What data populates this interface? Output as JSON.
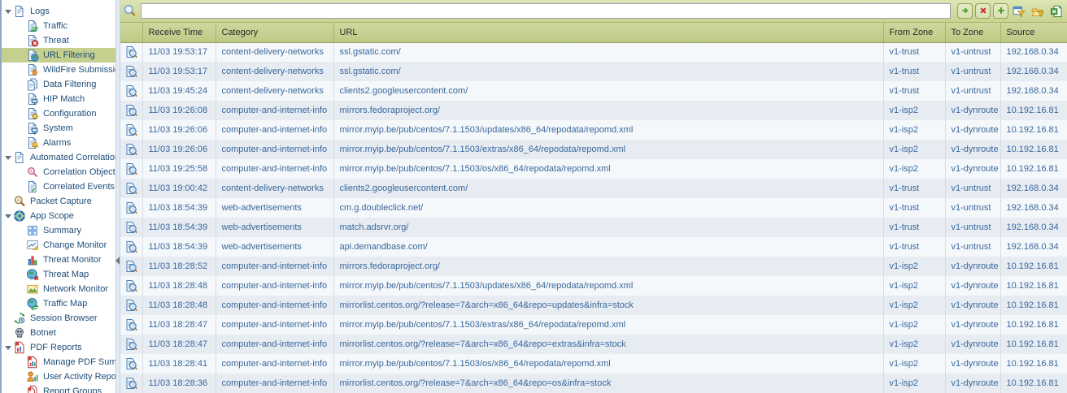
{
  "colors": {
    "accent_olive": "#c5cf8e",
    "header_olive": "#c4ce8c",
    "table_text_blue": "#39679b",
    "alt_row_blue": "#e7ecf3",
    "selected_nav_bg": "#c5cf8e"
  },
  "sidebar": {
    "items": [
      {
        "label": "Logs",
        "level": 0,
        "expandable": true,
        "expanded": true,
        "selected": false,
        "icon": "logs-icon"
      },
      {
        "label": "Traffic",
        "level": 1,
        "selected": false,
        "icon": "traffic-icon"
      },
      {
        "label": "Threat",
        "level": 1,
        "selected": false,
        "icon": "threat-icon"
      },
      {
        "label": "URL Filtering",
        "level": 1,
        "selected": true,
        "icon": "url-filtering-icon"
      },
      {
        "label": "WildFire Submissions",
        "level": 1,
        "selected": false,
        "icon": "wildfire-submissions-icon"
      },
      {
        "label": "Data Filtering",
        "level": 1,
        "selected": false,
        "icon": "data-filtering-icon"
      },
      {
        "label": "HIP Match",
        "level": 1,
        "selected": false,
        "icon": "hip-match-icon"
      },
      {
        "label": "Configuration",
        "level": 1,
        "selected": false,
        "icon": "configuration-icon"
      },
      {
        "label": "System",
        "level": 1,
        "selected": false,
        "icon": "system-icon"
      },
      {
        "label": "Alarms",
        "level": 1,
        "selected": false,
        "icon": "alarms-icon"
      },
      {
        "label": "Automated Correlation",
        "level": 0,
        "expandable": true,
        "expanded": true,
        "selected": false,
        "icon": "automated-correlation-icon"
      },
      {
        "label": "Correlation Objects",
        "level": 1,
        "selected": false,
        "icon": "correlation-objects-icon"
      },
      {
        "label": "Correlated Events",
        "level": 1,
        "selected": false,
        "icon": "correlated-events-icon"
      },
      {
        "label": "Packet Capture",
        "level": 0,
        "expandable": false,
        "selected": false,
        "icon": "packet-capture-icon"
      },
      {
        "label": "App Scope",
        "level": 0,
        "expandable": true,
        "expanded": true,
        "selected": false,
        "icon": "app-scope-icon"
      },
      {
        "label": "Summary",
        "level": 1,
        "selected": false,
        "icon": "summary-icon"
      },
      {
        "label": "Change Monitor",
        "level": 1,
        "selected": false,
        "icon": "change-monitor-icon"
      },
      {
        "label": "Threat Monitor",
        "level": 1,
        "selected": false,
        "icon": "threat-monitor-icon"
      },
      {
        "label": "Threat Map",
        "level": 1,
        "selected": false,
        "icon": "threat-map-icon"
      },
      {
        "label": "Network Monitor",
        "level": 1,
        "selected": false,
        "icon": "network-monitor-icon"
      },
      {
        "label": "Traffic Map",
        "level": 1,
        "selected": false,
        "icon": "traffic-map-icon"
      },
      {
        "label": "Session Browser",
        "level": 0,
        "expandable": false,
        "selected": false,
        "icon": "session-browser-icon"
      },
      {
        "label": "Botnet",
        "level": 0,
        "expandable": false,
        "selected": false,
        "icon": "botnet-icon"
      },
      {
        "label": "PDF Reports",
        "level": 0,
        "expandable": true,
        "expanded": true,
        "selected": false,
        "icon": "pdf-reports-icon"
      },
      {
        "label": "Manage PDF Summary",
        "level": 1,
        "selected": false,
        "icon": "manage-pdf-summary-icon"
      },
      {
        "label": "User Activity Report",
        "level": 1,
        "selected": false,
        "icon": "user-activity-report-icon"
      },
      {
        "label": "Report Groups",
        "level": 1,
        "selected": false,
        "icon": "report-groups-icon"
      }
    ]
  },
  "toolbar": {
    "filter_input": {
      "value": "",
      "placeholder": ""
    },
    "buttons": [
      {
        "name": "apply-filter-button",
        "icon": "apply-filter-icon",
        "boxed": true
      },
      {
        "name": "clear-filter-button",
        "icon": "clear-filter-icon",
        "boxed": true
      },
      {
        "name": "add-filter-button",
        "icon": "add-filter-icon",
        "boxed": true
      },
      {
        "name": "save-filter-button",
        "icon": "save-filter-icon",
        "boxed": false
      },
      {
        "name": "load-filter-button",
        "icon": "load-filter-icon",
        "boxed": false
      },
      {
        "name": "export-csv-button",
        "icon": "export-csv-icon",
        "boxed": false
      }
    ]
  },
  "table": {
    "columns": [
      {
        "key": "icon",
        "label": ""
      },
      {
        "key": "receive_time",
        "label": "Receive Time"
      },
      {
        "key": "category",
        "label": "Category"
      },
      {
        "key": "url",
        "label": "URL"
      },
      {
        "key": "from_zone",
        "label": "From Zone"
      },
      {
        "key": "to_zone",
        "label": "To Zone"
      },
      {
        "key": "source",
        "label": "Source"
      }
    ],
    "rows": [
      {
        "receive_time": "11/03 19:53:17",
        "category": "content-delivery-networks",
        "url": "ssl.gstatic.com/",
        "from_zone": "v1-trust",
        "to_zone": "v1-untrust",
        "source": "192.168.0.34"
      },
      {
        "receive_time": "11/03 19:53:17",
        "category": "content-delivery-networks",
        "url": "ssl.gstatic.com/",
        "from_zone": "v1-trust",
        "to_zone": "v1-untrust",
        "source": "192.168.0.34"
      },
      {
        "receive_time": "11/03 19:45:24",
        "category": "content-delivery-networks",
        "url": "clients2.googleusercontent.com/",
        "from_zone": "v1-trust",
        "to_zone": "v1-untrust",
        "source": "192.168.0.34"
      },
      {
        "receive_time": "11/03 19:26:08",
        "category": "computer-and-internet-info",
        "url": "mirrors.fedoraproject.org/",
        "from_zone": "v1-isp2",
        "to_zone": "v1-dynroute",
        "source": "10.192.16.81"
      },
      {
        "receive_time": "11/03 19:26:06",
        "category": "computer-and-internet-info",
        "url": "mirror.myip.be/pub/centos/7.1.1503/updates/x86_64/repodata/repomd.xml",
        "from_zone": "v1-isp2",
        "to_zone": "v1-dynroute",
        "source": "10.192.16.81"
      },
      {
        "receive_time": "11/03 19:26:06",
        "category": "computer-and-internet-info",
        "url": "mirror.myip.be/pub/centos/7.1.1503/extras/x86_64/repodata/repomd.xml",
        "from_zone": "v1-isp2",
        "to_zone": "v1-dynroute",
        "source": "10.192.16.81"
      },
      {
        "receive_time": "11/03 19:25:58",
        "category": "computer-and-internet-info",
        "url": "mirror.myip.be/pub/centos/7.1.1503/os/x86_64/repodata/repomd.xml",
        "from_zone": "v1-isp2",
        "to_zone": "v1-dynroute",
        "source": "10.192.16.81"
      },
      {
        "receive_time": "11/03 19:00:42",
        "category": "content-delivery-networks",
        "url": "clients2.googleusercontent.com/",
        "from_zone": "v1-trust",
        "to_zone": "v1-untrust",
        "source": "192.168.0.34"
      },
      {
        "receive_time": "11/03 18:54:39",
        "category": "web-advertisements",
        "url": "cm.g.doubleclick.net/",
        "from_zone": "v1-trust",
        "to_zone": "v1-untrust",
        "source": "192.168.0.34"
      },
      {
        "receive_time": "11/03 18:54:39",
        "category": "web-advertisements",
        "url": "match.adsrvr.org/",
        "from_zone": "v1-trust",
        "to_zone": "v1-untrust",
        "source": "192.168.0.34"
      },
      {
        "receive_time": "11/03 18:54:39",
        "category": "web-advertisements",
        "url": "api.demandbase.com/",
        "from_zone": "v1-trust",
        "to_zone": "v1-untrust",
        "source": "192.168.0.34"
      },
      {
        "receive_time": "11/03 18:28:52",
        "category": "computer-and-internet-info",
        "url": "mirrors.fedoraproject.org/",
        "from_zone": "v1-isp2",
        "to_zone": "v1-dynroute",
        "source": "10.192.16.81"
      },
      {
        "receive_time": "11/03 18:28:48",
        "category": "computer-and-internet-info",
        "url": "mirror.myip.be/pub/centos/7.1.1503/updates/x86_64/repodata/repomd.xml",
        "from_zone": "v1-isp2",
        "to_zone": "v1-dynroute",
        "source": "10.192.16.81"
      },
      {
        "receive_time": "11/03 18:28:48",
        "category": "computer-and-internet-info",
        "url": "mirrorlist.centos.org/?release=7&arch=x86_64&repo=updates&infra=stock",
        "from_zone": "v1-isp2",
        "to_zone": "v1-dynroute",
        "source": "10.192.16.81"
      },
      {
        "receive_time": "11/03 18:28:47",
        "category": "computer-and-internet-info",
        "url": "mirror.myip.be/pub/centos/7.1.1503/extras/x86_64/repodata/repomd.xml",
        "from_zone": "v1-isp2",
        "to_zone": "v1-dynroute",
        "source": "10.192.16.81"
      },
      {
        "receive_time": "11/03 18:28:47",
        "category": "computer-and-internet-info",
        "url": "mirrorlist.centos.org/?release=7&arch=x86_64&repo=extras&infra=stock",
        "from_zone": "v1-isp2",
        "to_zone": "v1-dynroute",
        "source": "10.192.16.81"
      },
      {
        "receive_time": "11/03 18:28:41",
        "category": "computer-and-internet-info",
        "url": "mirror.myip.be/pub/centos/7.1.1503/os/x86_64/repodata/repomd.xml",
        "from_zone": "v1-isp2",
        "to_zone": "v1-dynroute",
        "source": "10.192.16.81"
      },
      {
        "receive_time": "11/03 18:28:36",
        "category": "computer-and-internet-info",
        "url": "mirrorlist.centos.org/?release=7&arch=x86_64&repo=os&infra=stock",
        "from_zone": "v1-isp2",
        "to_zone": "v1-dynroute",
        "source": "10.192.16.81"
      }
    ]
  }
}
